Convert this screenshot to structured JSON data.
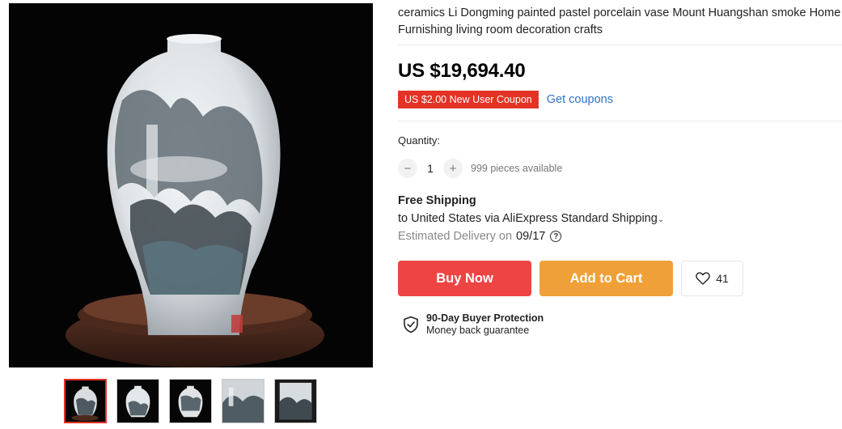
{
  "product": {
    "title": "ceramics Li Dongming painted pastel porcelain vase Mount Huangshan smoke Home Furnishing living room decoration crafts",
    "price": "US $19,694.40",
    "coupon_label": "US $2.00 New User Coupon",
    "get_coupons_label": "Get coupons"
  },
  "quantity": {
    "label": "Quantity:",
    "minus": "−",
    "plus": "+",
    "value": "1",
    "available": "999 pieces available"
  },
  "shipping": {
    "title": "Free Shipping",
    "method": "to United States via AliExpress Standard Shipping",
    "delivery_label": "Estimated Delivery on",
    "delivery_date": "09/17",
    "help": "?"
  },
  "actions": {
    "buy_now": "Buy Now",
    "add_to_cart": "Add to Cart",
    "wishlist_count": "41"
  },
  "protection": {
    "title": "90-Day Buyer Protection",
    "subtitle": "Money back guarantee"
  },
  "gallery": {
    "thumbnail_count": 5,
    "active_index": 0
  },
  "colors": {
    "buy_now": "#ee4444",
    "add_to_cart": "#f0a038",
    "coupon": "#e43225",
    "link": "#2e72c6"
  }
}
